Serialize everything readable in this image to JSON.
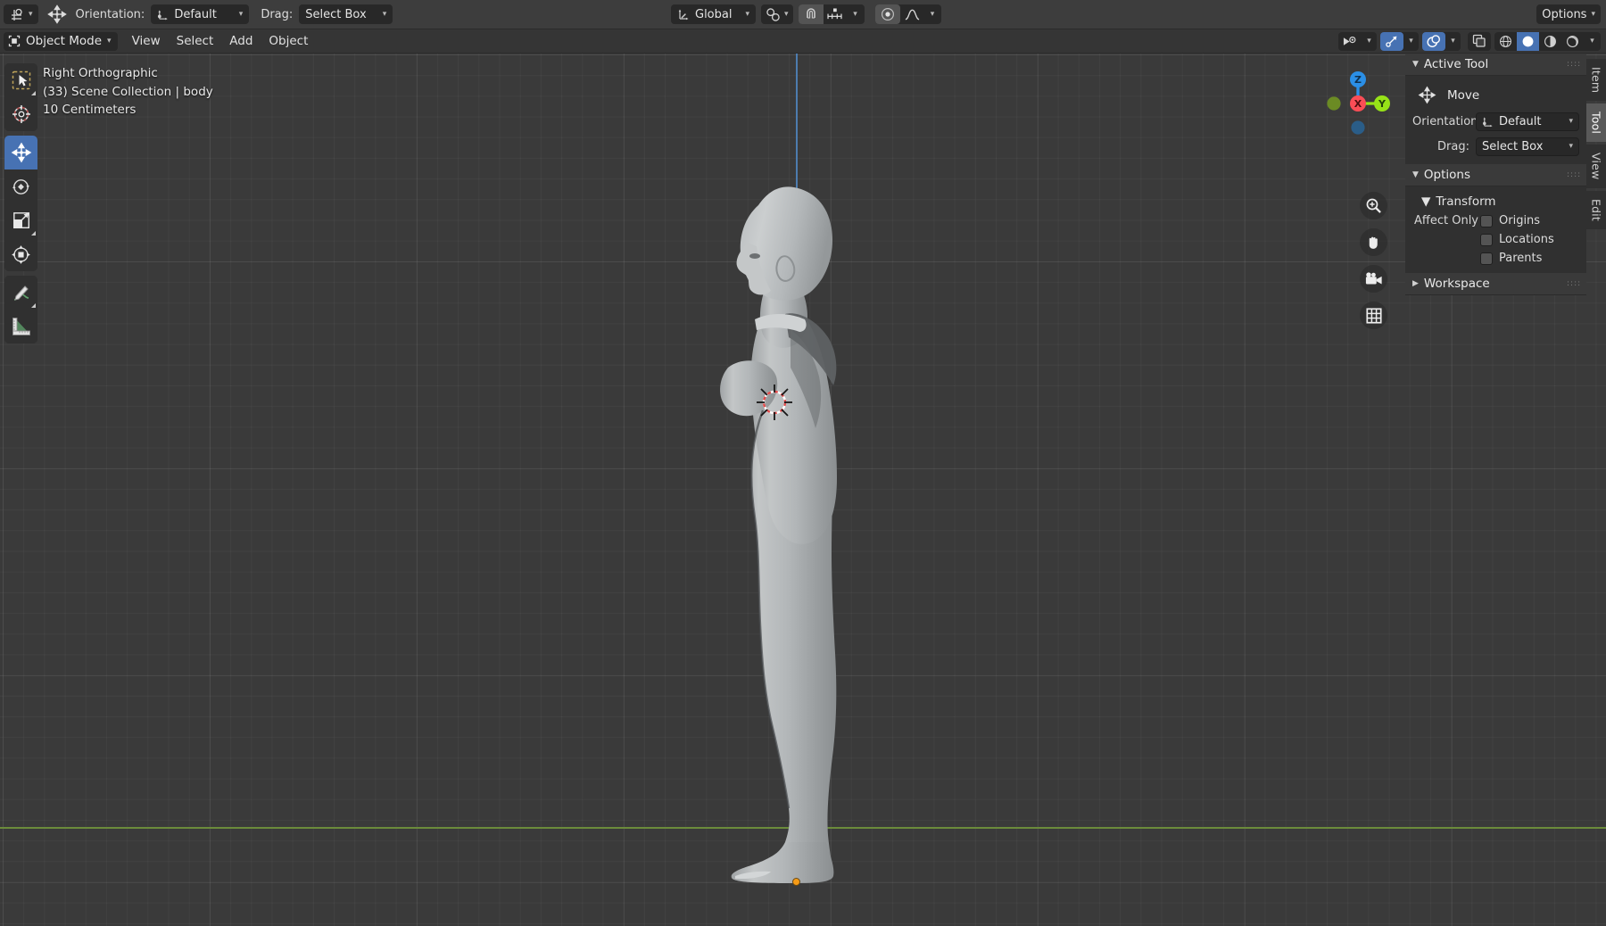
{
  "app": "Blender 3D Viewport",
  "topbar": {
    "tool_icon": "cursor-tool-icon",
    "active_tool_icon": "move-tool-icon",
    "orientation_label": "Orientation:",
    "orientation_value": "Default",
    "drag_label": "Drag:",
    "drag_value": "Select Box",
    "transform_orientation": "Global",
    "snap_icon": "snap-magnet-icon",
    "snap_to": "snap-increment-icon",
    "proportional_icon": "proportional-editing-icon",
    "proportional_falloff_icon": "smooth-falloff-icon",
    "options_label": "Options"
  },
  "header": {
    "mode": "Object Mode",
    "menus": [
      "View",
      "Select",
      "Add",
      "Object"
    ],
    "right_icons": [
      "visibility-eye-icon",
      "gizmo-icon",
      "overlays-icon",
      "xray-toggle-icon",
      "shading-wireframe-icon",
      "shading-solid-icon",
      "shading-material-icon",
      "shading-rendered-icon"
    ]
  },
  "viewport": {
    "view_name": "Right Orthographic",
    "scene_info": "(33) Scene Collection | body",
    "grid_scale": "10 Centimeters",
    "axis_z_color": "#4e7fb5",
    "axis_y_color": "#6b8b3b",
    "background_color": "#3a3a3a",
    "origin_dot_color": "#f59b17",
    "gizmo": {
      "x_label": "X",
      "y_label": "Y",
      "z_label": "Z",
      "x_color": "#fa4d56",
      "y_color": "#97e318",
      "z_color": "#2b8fe6",
      "neg_y_color": "#6b8b24",
      "neg_z_color": "#2a5d88"
    },
    "nav_buttons": [
      "zoom-icon",
      "pan-hand-icon",
      "camera-icon",
      "grid-ortho-icon"
    ]
  },
  "toolbar": {
    "tools": [
      {
        "name": "tweak-select-box-tool",
        "icon": "select-box-icon",
        "active": false,
        "corner": true
      },
      {
        "name": "cursor-tool",
        "icon": "3d-cursor-icon",
        "active": false,
        "corner": false
      },
      {
        "name": "move-tool",
        "icon": "move-arrows-icon",
        "active": true,
        "corner": false
      },
      {
        "name": "rotate-tool",
        "icon": "rotate-icon",
        "active": false,
        "corner": false
      },
      {
        "name": "scale-tool",
        "icon": "scale-icon",
        "active": false,
        "corner": true
      },
      {
        "name": "transform-tool",
        "icon": "transform-icon",
        "active": false,
        "corner": false
      },
      {
        "name": "annotate-tool",
        "icon": "annotate-pencil-icon",
        "active": false,
        "corner": true
      },
      {
        "name": "measure-tool",
        "icon": "measure-ruler-icon",
        "active": false,
        "corner": false
      }
    ]
  },
  "sidebar": {
    "active_tool_panel": {
      "title": "Active Tool",
      "tool_name": "Move",
      "tool_icon": "move-arrows-icon",
      "orientation_label": "Orientation",
      "orientation_value": "Default",
      "drag_label": "Drag:",
      "drag_value": "Select Box"
    },
    "options_panel": {
      "title": "Options",
      "transform_label": "Transform",
      "affect_only_label": "Affect Only",
      "checkboxes": [
        {
          "label": "Origins",
          "checked": false
        },
        {
          "label": "Locations",
          "checked": false
        },
        {
          "label": "Parents",
          "checked": false
        }
      ]
    },
    "workspace_panel": {
      "title": "Workspace"
    },
    "tabs": [
      {
        "label": "Item",
        "active": false
      },
      {
        "label": "Tool",
        "active": true
      },
      {
        "label": "View",
        "active": false
      },
      {
        "label": "Edit",
        "active": false
      }
    ]
  }
}
